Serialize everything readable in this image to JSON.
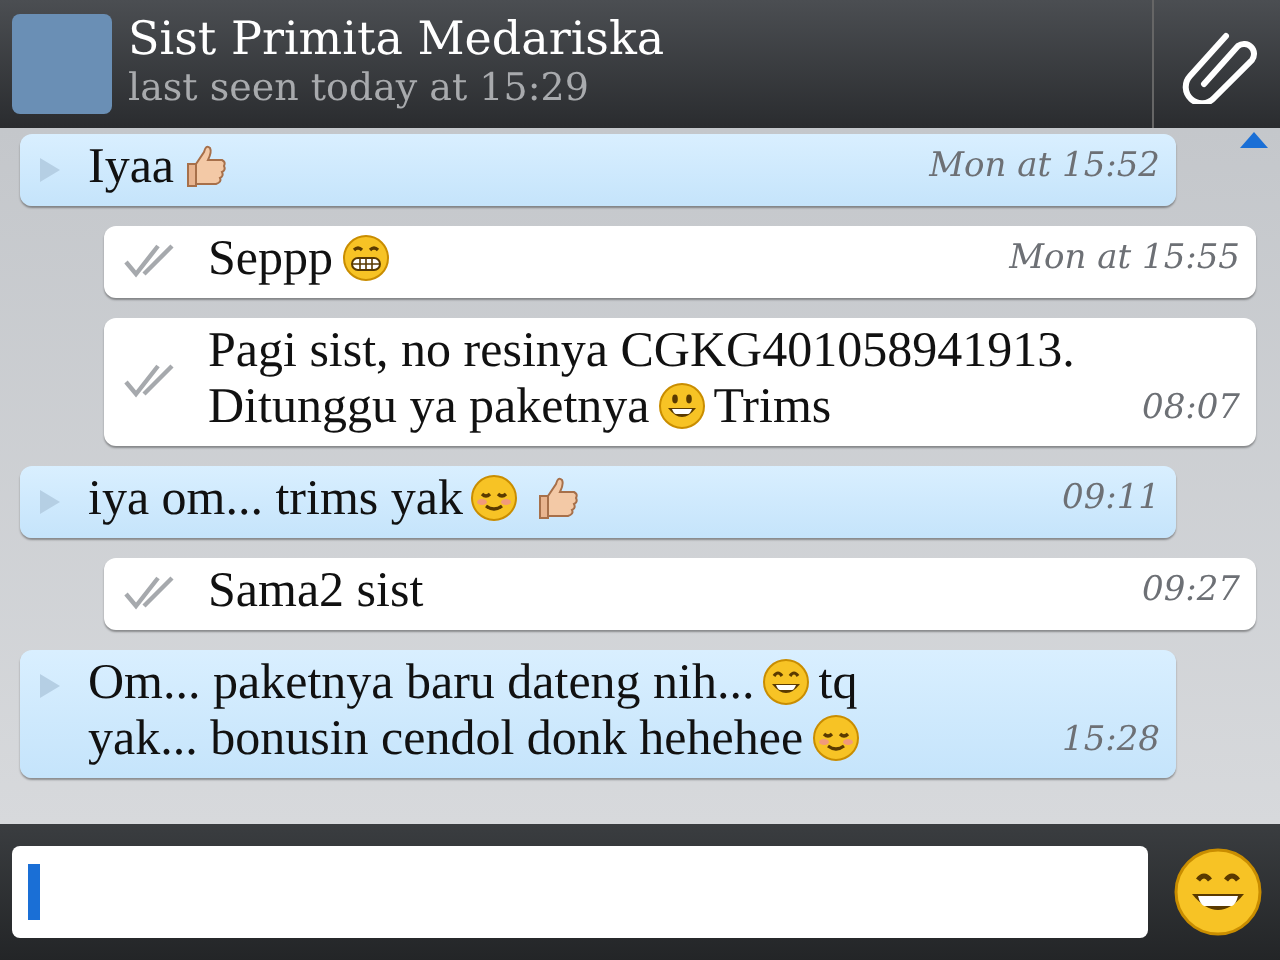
{
  "header": {
    "contact_name": "Sist Primita Medariska",
    "last_seen": "last seen today at 15:29"
  },
  "messages": [
    {
      "outgoing": false,
      "time": "Mon at 15:52",
      "lines": [
        [
          {
            "kind": "text",
            "text": "Iyaa"
          },
          {
            "kind": "thumbs"
          }
        ]
      ]
    },
    {
      "outgoing": true,
      "delivered": true,
      "time": "Mon at 15:55",
      "lines": [
        [
          {
            "kind": "text",
            "text": "Seppp"
          },
          {
            "kind": "grimace"
          }
        ]
      ]
    },
    {
      "outgoing": true,
      "delivered": true,
      "time": "08:07",
      "lines": [
        [
          {
            "kind": "text",
            "text": "Pagi sist, no resinya CGKG401058941913."
          }
        ],
        [
          {
            "kind": "text",
            "text": "Ditunggu ya paketnya"
          },
          {
            "kind": "smile"
          },
          {
            "kind": "text",
            "text": "Trims"
          }
        ]
      ]
    },
    {
      "outgoing": false,
      "time": "09:11",
      "lines": [
        [
          {
            "kind": "text",
            "text": "iya om... trims yak"
          },
          {
            "kind": "blush"
          },
          {
            "kind": "thumbs"
          }
        ]
      ]
    },
    {
      "outgoing": true,
      "delivered": true,
      "time": "09:27",
      "lines": [
        [
          {
            "kind": "text",
            "text": "Sama2 sist"
          }
        ]
      ]
    },
    {
      "outgoing": false,
      "time": "15:28",
      "lines": [
        [
          {
            "kind": "text",
            "text": "Om... paketnya baru dateng nih..."
          },
          {
            "kind": "grin"
          },
          {
            "kind": "text",
            "text": "tq"
          }
        ],
        [
          {
            "kind": "text",
            "text": "yak... bonusin cendol donk hehehee"
          },
          {
            "kind": "blush"
          }
        ]
      ]
    }
  ]
}
